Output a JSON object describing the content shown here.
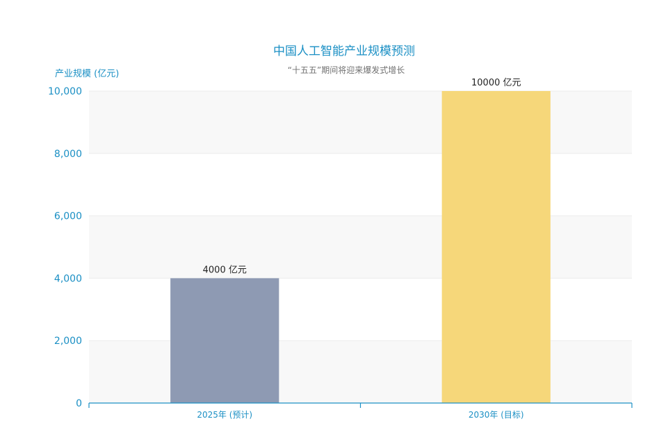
{
  "chart_data": {
    "type": "bar",
    "title": "中国人工智能产业规模预测",
    "subtitle": "“十五五”期间将迎来爆发式增长",
    "ylabel": "产业规模 (亿元)",
    "xlabel": "",
    "categories": [
      "2025年 (预计)",
      "2030年 (目标)"
    ],
    "values": [
      4000,
      10000
    ],
    "data_labels": [
      "4000 亿元",
      "10000 亿元"
    ],
    "ylim": [
      0,
      10000
    ],
    "yticks": [
      0,
      2000,
      4000,
      6000,
      8000,
      10000
    ],
    "ytick_labels": [
      "0",
      "2,000",
      "4,000",
      "6,000",
      "8,000",
      "10,000"
    ],
    "colors": [
      "#8e9ab3",
      "#f6d77a"
    ],
    "axis_color": "#1a8fc4",
    "band_color": "#f8f8f8",
    "grid": true,
    "legend": "none"
  }
}
